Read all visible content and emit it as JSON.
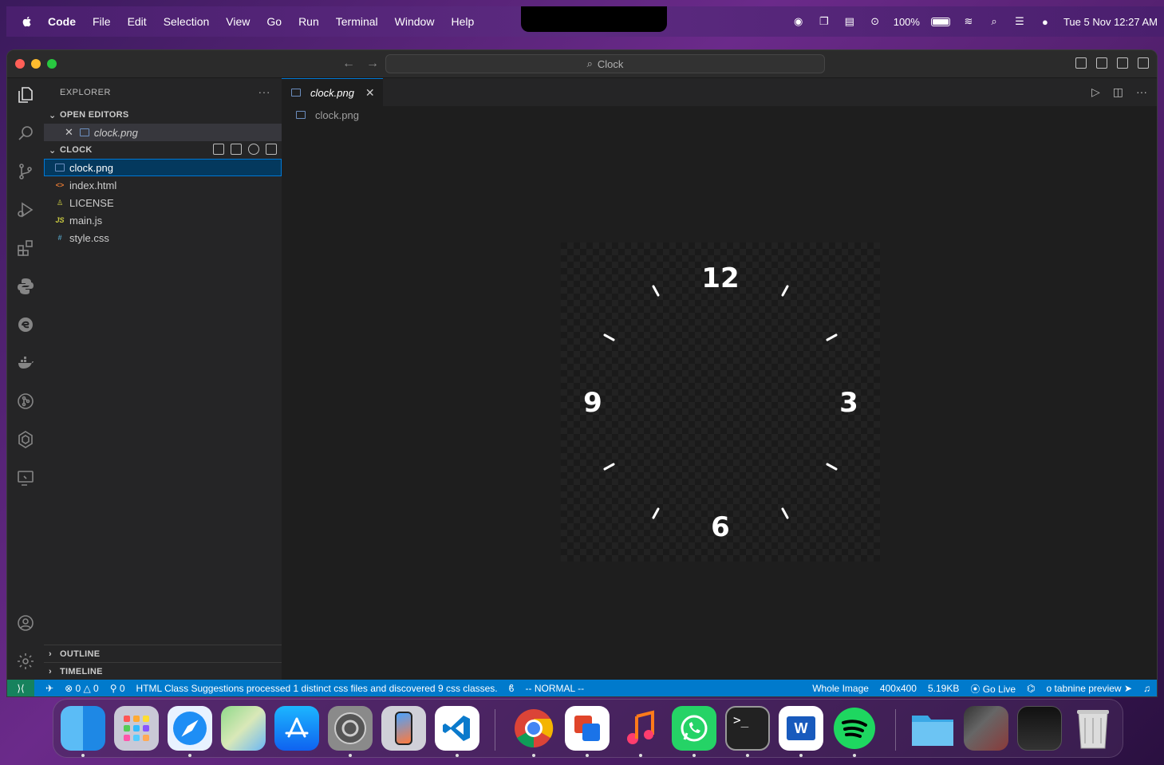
{
  "menubar": {
    "app": "Code",
    "items": [
      "File",
      "Edit",
      "Selection",
      "View",
      "Go",
      "Run",
      "Terminal",
      "Window",
      "Help"
    ],
    "battery": "100%",
    "datetime": "Tue 5 Nov  12:27 AM"
  },
  "window": {
    "search": "Clock"
  },
  "sidebar": {
    "title": "EXPLORER",
    "open_editors_label": "OPEN EDITORS",
    "open_editor_file": "clock.png",
    "folder_label": "CLOCK",
    "files": [
      {
        "name": "clock.png",
        "icon": "image-icon"
      },
      {
        "name": "index.html",
        "icon": "html-icon"
      },
      {
        "name": "LICENSE",
        "icon": "license-icon"
      },
      {
        "name": "main.js",
        "icon": "js-icon"
      },
      {
        "name": "style.css",
        "icon": "css-icon"
      }
    ],
    "outline_label": "OUTLINE",
    "timeline_label": "TIMELINE"
  },
  "editor": {
    "tab_label": "clock.png",
    "breadcrumb": "clock.png",
    "clock_numbers": {
      "n12": "12",
      "n3": "3",
      "n6": "6",
      "n9": "9"
    }
  },
  "statusbar": {
    "errors": "0",
    "warnings": "0",
    "ports": "0",
    "message": "HTML Class Suggestions processed 1 distinct css files and discovered 9 css classes.",
    "mode": "-- NORMAL --",
    "view": "Whole Image",
    "dimensions": "400x400",
    "size": "5.19KB",
    "golive": "Go Live",
    "tabnine": "tabnine preview"
  },
  "dock": {
    "apps": [
      "finder-icon",
      "launchpad-icon",
      "safari-icon",
      "maps-icon",
      "app-store-icon",
      "system-settings-icon",
      "iphone-mirroring-icon",
      "vscode-icon",
      "chrome-icon",
      "remote-desktop-icon",
      "music-icon",
      "whatsapp-icon",
      "terminal-icon",
      "word-icon",
      "spotify-icon",
      "folder-icon",
      "photo-thumbnail-icon",
      "screen-thumbnail-icon",
      "trash-icon"
    ]
  }
}
